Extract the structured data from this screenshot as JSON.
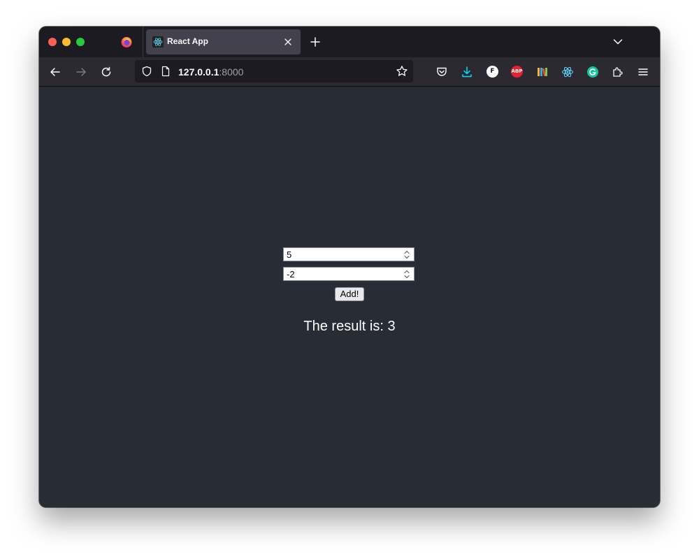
{
  "browser": {
    "tab": {
      "title": "React App"
    },
    "url": {
      "host": "127.0.0.1",
      "port": ":8000"
    },
    "extensions": {
      "abp_label": "ABP",
      "f_label": "F"
    }
  },
  "app": {
    "first_number": "5",
    "second_number": "-2",
    "add_button_label": "Add!",
    "result_text": "The result is: 3"
  },
  "colors": {
    "page_background": "#282c34",
    "toolbar": "#2b2a33",
    "tabbar": "#1c1b22",
    "react_blue": "#61dafb"
  }
}
